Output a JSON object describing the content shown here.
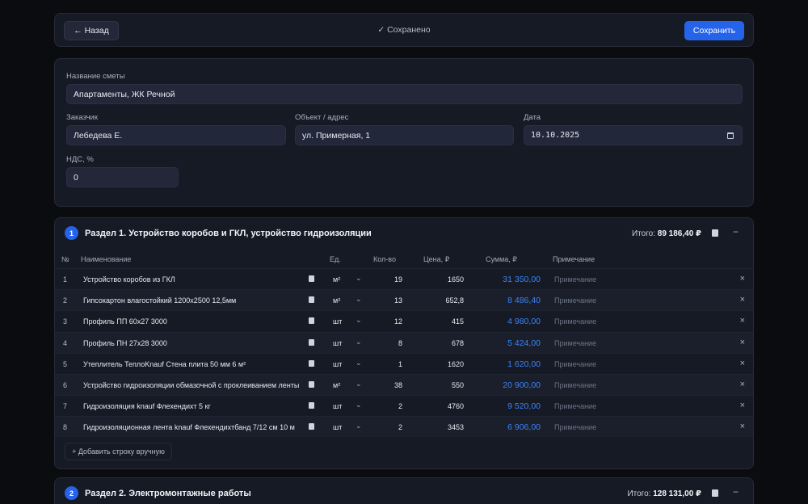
{
  "toolbar": {
    "back_label": "← Назад",
    "saved_status": "✓ Сохранено",
    "save_label": "Сохранить"
  },
  "form": {
    "estimate_name_label": "Название сметы",
    "estimate_name_value": "Апартаменты, ЖК Речной",
    "customer_label": "Заказчик",
    "customer_value": "Лебедева Е.",
    "object_label": "Объект / адрес",
    "object_value": "ул. Примерная, 1",
    "date_label": "Дата",
    "date_value": "10.10.2025",
    "vat_label": "НДС, %",
    "vat_value": "0"
  },
  "table_headers": {
    "num": "№",
    "name": "Наименование",
    "unit": "Ед.",
    "qty": "Кол-во",
    "price": "Цена, ₽",
    "sum": "Сумма, ₽",
    "note": "Примечание"
  },
  "sections": [
    {
      "number": "1",
      "title": "Раздел 1. Устройство коробов и ГКЛ, устройство гидроизоляции",
      "total_label": "Итого:",
      "total_value": "89 186,40 ₽",
      "rows": [
        {
          "num": "1",
          "name": "Устройство коробов из ГКЛ",
          "unit": "м²",
          "qty": "19",
          "price": "1650",
          "sum": "31 350,00",
          "note": "Примечание"
        },
        {
          "num": "2",
          "name": "Гипсокартон влагостойкий 1200х2500 12,5мм",
          "unit": "м²",
          "qty": "13",
          "price": "652,8",
          "sum": "8 486,40",
          "note": "Примечание"
        },
        {
          "num": "3",
          "name": "Профиль ПП 60х27 3000",
          "unit": "шт",
          "qty": "12",
          "price": "415",
          "sum": "4 980,00",
          "note": "Примечание"
        },
        {
          "num": "4",
          "name": "Профиль ПН 27х28 3000",
          "unit": "шт",
          "qty": "8",
          "price": "678",
          "sum": "5 424,00",
          "note": "Примечание"
        },
        {
          "num": "5",
          "name": "Утеплитель ТеплоKnauf Стена плита 50 мм 6 м²",
          "unit": "шт",
          "qty": "1",
          "price": "1620",
          "sum": "1 620,00",
          "note": "Примечание"
        },
        {
          "num": "6",
          "name": "Устройство гидроизоляции обмазочной с проклеиванием ленты",
          "unit": "м²",
          "qty": "38",
          "price": "550",
          "sum": "20 900,00",
          "note": "Примечание"
        },
        {
          "num": "7",
          "name": "Гидроизоляция knauf  Флехендихт 5 кг",
          "unit": "шт",
          "qty": "2",
          "price": "4760",
          "sum": "9 520,00",
          "note": "Примечание"
        },
        {
          "num": "8",
          "name": "Гидроизоляционная лента  knauf  Флехендихтбанд 7/12 см 10 м",
          "unit": "шт",
          "qty": "2",
          "price": "3453",
          "sum": "6 906,00",
          "note": "Примечание"
        }
      ],
      "add_row_label": "+ Добавить строку вручную"
    },
    {
      "number": "2",
      "title": "Раздел 2. Электромонтажные работы",
      "total_label": "Итого:",
      "total_value": "128 131,00 ₽"
    }
  ],
  "icons": {
    "delete": "×",
    "collapse": "−",
    "chevron": "⌄"
  }
}
